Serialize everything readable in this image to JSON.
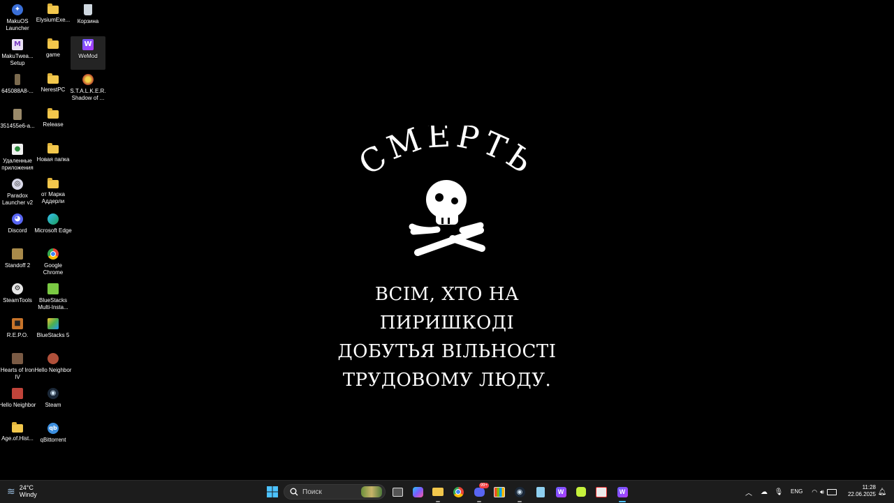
{
  "desktop": {
    "icons": [
      {
        "label": "MakuOS Launcher"
      },
      {
        "label": "ElysiumExe..."
      },
      {
        "label": "Корзина"
      },
      {
        "label": "MakuTwea... Setup"
      },
      {
        "label": "game"
      },
      {
        "label": "WeMod"
      },
      {
        "label": "645088A8-..."
      },
      {
        "label": "NerestPC"
      },
      {
        "label": "S.T.A.L.K.E.R. Shadow of ..."
      },
      {
        "label": "351455e6-a..."
      },
      {
        "label": "Release"
      },
      {
        "label": "Удаленные приложения"
      },
      {
        "label": "Новая папка"
      },
      {
        "label": "Paradox Launcher v2"
      },
      {
        "label": "от Марка Аддерли"
      },
      {
        "label": "Discord"
      },
      {
        "label": "Microsoft Edge"
      },
      {
        "label": "Standoff 2"
      },
      {
        "label": "Google Chrome"
      },
      {
        "label": "SteamTools"
      },
      {
        "label": "BlueStacks Multi-Insta..."
      },
      {
        "label": "R.E.P.O."
      },
      {
        "label": "BlueStacks 5"
      },
      {
        "label": "Hearts of Iron IV"
      },
      {
        "label": "Hello Neighbor"
      },
      {
        "label": "Hello Neighbor"
      },
      {
        "label": "Steam"
      },
      {
        "label": "Age.of.Hist..."
      },
      {
        "label": "qBittorrent"
      }
    ]
  },
  "wallpaper": {
    "title": "СМЕРТЬ",
    "lines": [
      "ВСІМ, ХТО НА ПИРИШКОДІ",
      "ДОБУТЬЯ ВІЛЬНОСТІ",
      "ТРУДОВОМУ ЛЮДУ."
    ]
  },
  "taskbar": {
    "weather": {
      "temp": "24°C",
      "desc": "Windy"
    },
    "search_placeholder": "Поиск",
    "language": "ENG",
    "time": "11:28",
    "date": "22.06.2025",
    "discord_badge": "99+"
  },
  "colors": {
    "taskbar_bg": "#1c1c1c",
    "folder": "#f2c74c",
    "accent": "#0078d4"
  }
}
